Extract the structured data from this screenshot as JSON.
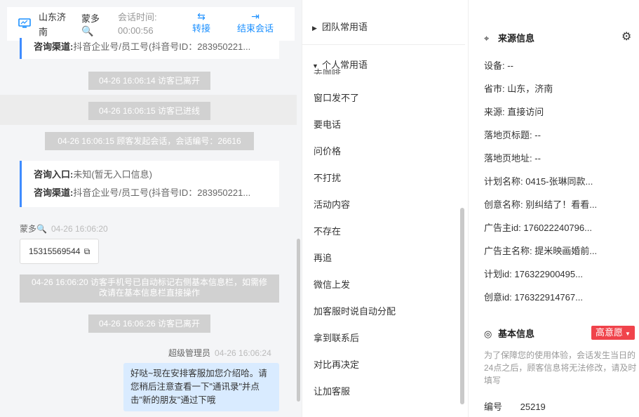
{
  "header": {
    "location": "山东济南",
    "visitor_name": "蒙多",
    "visitor_icon": "🔍",
    "timer_label": "会话时间:",
    "timer_value": "00:00:56",
    "transfer_label": "转接",
    "end_label": "结束会话"
  },
  "chat": {
    "card1": {
      "channel_label": "咨询渠道:",
      "channel_value": "抖音企业号/员工号(抖音号ID：283950221..."
    },
    "sys1": "04-26 16:06:14 访客已离开",
    "sys2": "04-26 16:06:15 访客已进线",
    "sys3": "04-26 16:06:15 顾客发起会话，会话编号：26616",
    "card2": {
      "entry_label": "咨询入口:",
      "entry_value": "未知(暂无入口信息)",
      "channel_label": "咨询渠道:",
      "channel_value": "抖音企业号/员工号(抖音号ID：283950221..."
    },
    "visitor_sender": "蒙多🔍",
    "visitor_time": "04-26 16:06:20",
    "phone": "15315569544",
    "sys4": "04-26 16:06:20 访客手机号已自动标记右侧基本信息栏，如需修改请在基本信息栏直接操作",
    "sys5": "04-26 16:06:26 访客已离开",
    "agent_sender": "超级管理员",
    "agent_time": "04-26 16:06:24",
    "agent_message": "好哒~现在安排客服加您介绍哈。请您稍后注意查看一下\"通讯录\"并点击\"新的朋友\"通过下哦"
  },
  "phrases": {
    "team_group": "团队常用语",
    "personal_group": "个人常用语",
    "partial_top": "去咖啡",
    "items": [
      "窗口发不了",
      "要电话",
      "问价格",
      "不打扰",
      "活动内容",
      "不存在",
      "再追",
      "微信上发",
      "加客服时说自动分配",
      "拿到联系后",
      "对比再决定",
      "让加客服"
    ]
  },
  "source": {
    "title": "来源信息",
    "rows": [
      {
        "label": "设备:",
        "value": "--"
      },
      {
        "label": "省市:",
        "value": "山东，济南"
      },
      {
        "label": "来源:",
        "value": "直接访问"
      },
      {
        "label": "落地页标题:",
        "value": "--"
      },
      {
        "label": "落地页地址:",
        "value": "--"
      },
      {
        "label": "计划名称:",
        "value": "0415-张琳同款..."
      },
      {
        "label": "创意名称:",
        "value": "别纠结了！看看..."
      },
      {
        "label": "广告主id:",
        "value": "176022240796..."
      },
      {
        "label": "广告主名称:",
        "value": "提米映画婚前..."
      },
      {
        "label": "计划id:",
        "value": "176322900495..."
      },
      {
        "label": "创意id:",
        "value": "176322914767..."
      }
    ]
  },
  "basic": {
    "title": "基本信息",
    "intent_tag": "高意愿",
    "note": "为了保障您的使用体验，会话发生当日的24点之后，顾客信息将无法修改，请及时填写",
    "id_label": "编号",
    "id_value": "25219"
  },
  "colors": {
    "accent": "#1a8fff",
    "tag": "#f0434b",
    "bubble": "#d9ebff",
    "system": "#d1d1d1"
  }
}
